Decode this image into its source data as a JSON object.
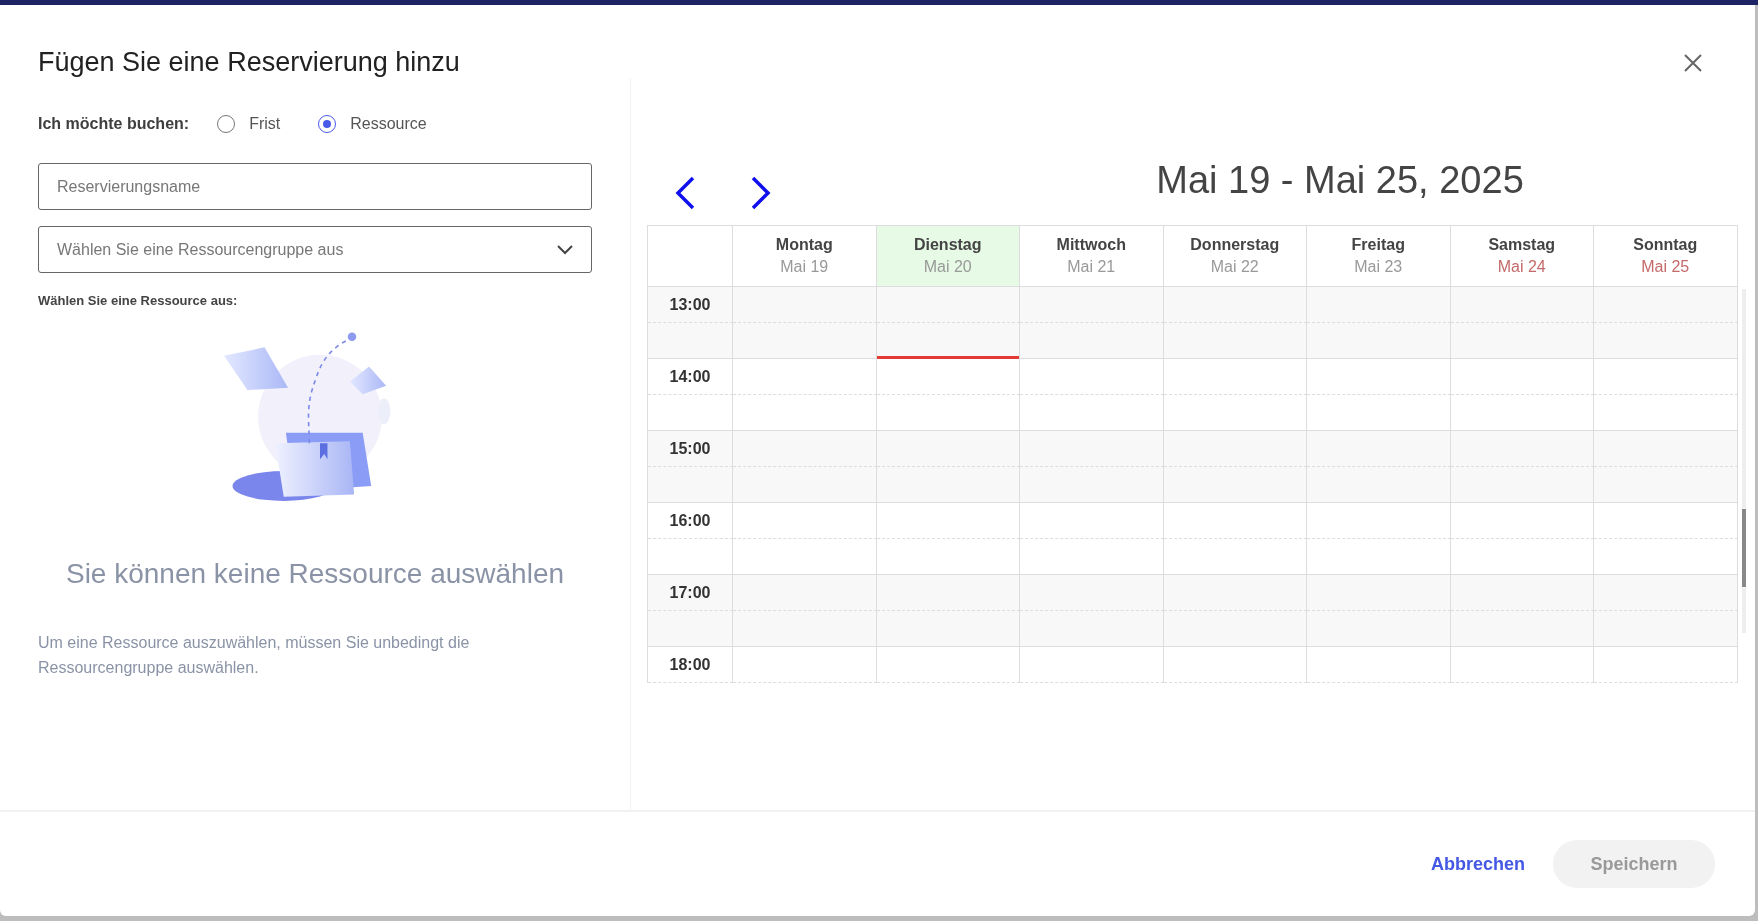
{
  "dialog": {
    "title": "Fügen Sie eine Reservierung hinzu"
  },
  "booking_type": {
    "label": "Ich möchte buchen:",
    "options": [
      {
        "label": "Frist",
        "selected": false
      },
      {
        "label": "Ressource",
        "selected": true
      }
    ]
  },
  "name_field": {
    "placeholder": "Reservierungsname"
  },
  "group_select": {
    "placeholder": "Wählen Sie eine Ressourcengruppe aus"
  },
  "resource_label": "Wählen Sie eine Ressource aus:",
  "empty_state": {
    "title": "Sie können keine Ressource auswählen",
    "text": "Um eine Ressource auszuwählen, müssen Sie unbedingt die Ressourcengruppe auswählen."
  },
  "calendar": {
    "range": "Mai 19 - Mai 25, 2025",
    "days": [
      {
        "name": "Montag",
        "date": "Mai 19",
        "today": false,
        "weekend": false
      },
      {
        "name": "Dienstag",
        "date": "Mai 20",
        "today": true,
        "weekend": false
      },
      {
        "name": "Mittwoch",
        "date": "Mai 21",
        "today": false,
        "weekend": false
      },
      {
        "name": "Donnerstag",
        "date": "Mai 22",
        "today": false,
        "weekend": false
      },
      {
        "name": "Freitag",
        "date": "Mai 23",
        "today": false,
        "weekend": false
      },
      {
        "name": "Samstag",
        "date": "Mai 24",
        "today": false,
        "weekend": true
      },
      {
        "name": "Sonntag",
        "date": "Mai 25",
        "today": false,
        "weekend": true
      }
    ],
    "hours": [
      "13:00",
      "14:00",
      "15:00",
      "16:00",
      "17:00",
      "18:00"
    ]
  },
  "footer": {
    "cancel": "Abbrechen",
    "save": {
      "label": "Speichern",
      "disabled": true
    }
  }
}
